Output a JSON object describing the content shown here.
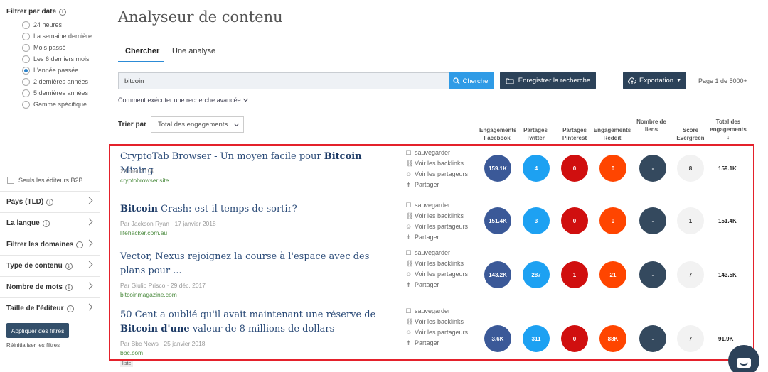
{
  "sidebar": {
    "date_filter_title": "Filtrer par date",
    "date_options": [
      "24 heures",
      "La semaine dernière",
      "Mois passé",
      "Les 6 derniers mois",
      "L'année passée",
      "2 dernières années",
      "5 dernières années",
      "Gamme spécifique"
    ],
    "selected_date": "L'année passée",
    "b2b_label": "Seuls les éditeurs B2B",
    "filters": [
      "Pays (TLD)",
      "La langue",
      "Filtrer les domaines",
      "Type de contenu",
      "Nombre de mots",
      "Taille de l'éditeur"
    ],
    "apply_label": "Appliquer des filtres",
    "reset_label": "Réinitialiser les filtres"
  },
  "header": {
    "title": "Analyseur de contenu",
    "tabs": [
      "Chercher",
      "Une analyse"
    ]
  },
  "search": {
    "value": "bitcoin",
    "search_btn": "Chercher",
    "save_btn": "Enregistrer la recherche",
    "export_btn": "Exportation",
    "page_info": "Page 1 de 5000+",
    "advanced_link": "Comment exécuter une recherche avancée"
  },
  "sort": {
    "label": "Trier par",
    "value": "Total des engagements"
  },
  "columns": [
    "Engagements Facebook",
    "Partages Twitter",
    "Partages Pinterest",
    "Engagements Reddit",
    "Nombre de liens",
    "Score Evergreen",
    "Total des engagements ↓"
  ],
  "actions": [
    "sauvegarder",
    "Voir les backlinks",
    "Voir les partageurs",
    "Partager"
  ],
  "results": [
    {
      "title_parts": [
        [
          "CryptoTab Browser - Un moyen facile pour ",
          false
        ],
        [
          "Bitcoin",
          true
        ],
        [
          " Mining",
          false
        ]
      ],
      "meta": "29 mai 2018",
      "domain": "cryptobrowser.site",
      "fb": "159.1K",
      "tw": "4",
      "pi": "0",
      "rd": "0",
      "ln": "-",
      "ev": "8",
      "total": "159.1K"
    },
    {
      "title_parts": [
        [
          "Bitcoin",
          true
        ],
        [
          " Crash: est-il temps de sortir?",
          false
        ]
      ],
      "meta": "Par Jackson Ryan · 17 janvier 2018",
      "domain": "lifehacker.com.au",
      "fb": "151.4K",
      "tw": "3",
      "pi": "0",
      "rd": "0",
      "ln": "-",
      "ev": "1",
      "total": "151.4K"
    },
    {
      "title_parts": [
        [
          "Vector, Nexus rejoignez la course à l'espace avec des plans pour ...",
          false
        ]
      ],
      "meta": "Par Giulio Prisco · 29 déc. 2017",
      "domain": "bitcoinmagazine.com",
      "fb": "143.2K",
      "tw": "287",
      "pi": "1",
      "rd": "21",
      "ln": "-",
      "ev": "7",
      "total": "143.5K"
    },
    {
      "title_parts": [
        [
          "50 Cent a oublié qu'il avait maintenant une réserve de ",
          false
        ],
        [
          "Bitcoin d'une",
          true
        ],
        [
          " valeur de 8 millions de dollars",
          false
        ]
      ],
      "meta": "Par Bbc News · 25 janvier 2018",
      "domain": "bbc.com",
      "fb": "3.6K",
      "tw": "311",
      "pi": "0",
      "rd": "88K",
      "ln": "-",
      "ev": "7",
      "total": "91.9K"
    }
  ],
  "list_badge": "liste"
}
